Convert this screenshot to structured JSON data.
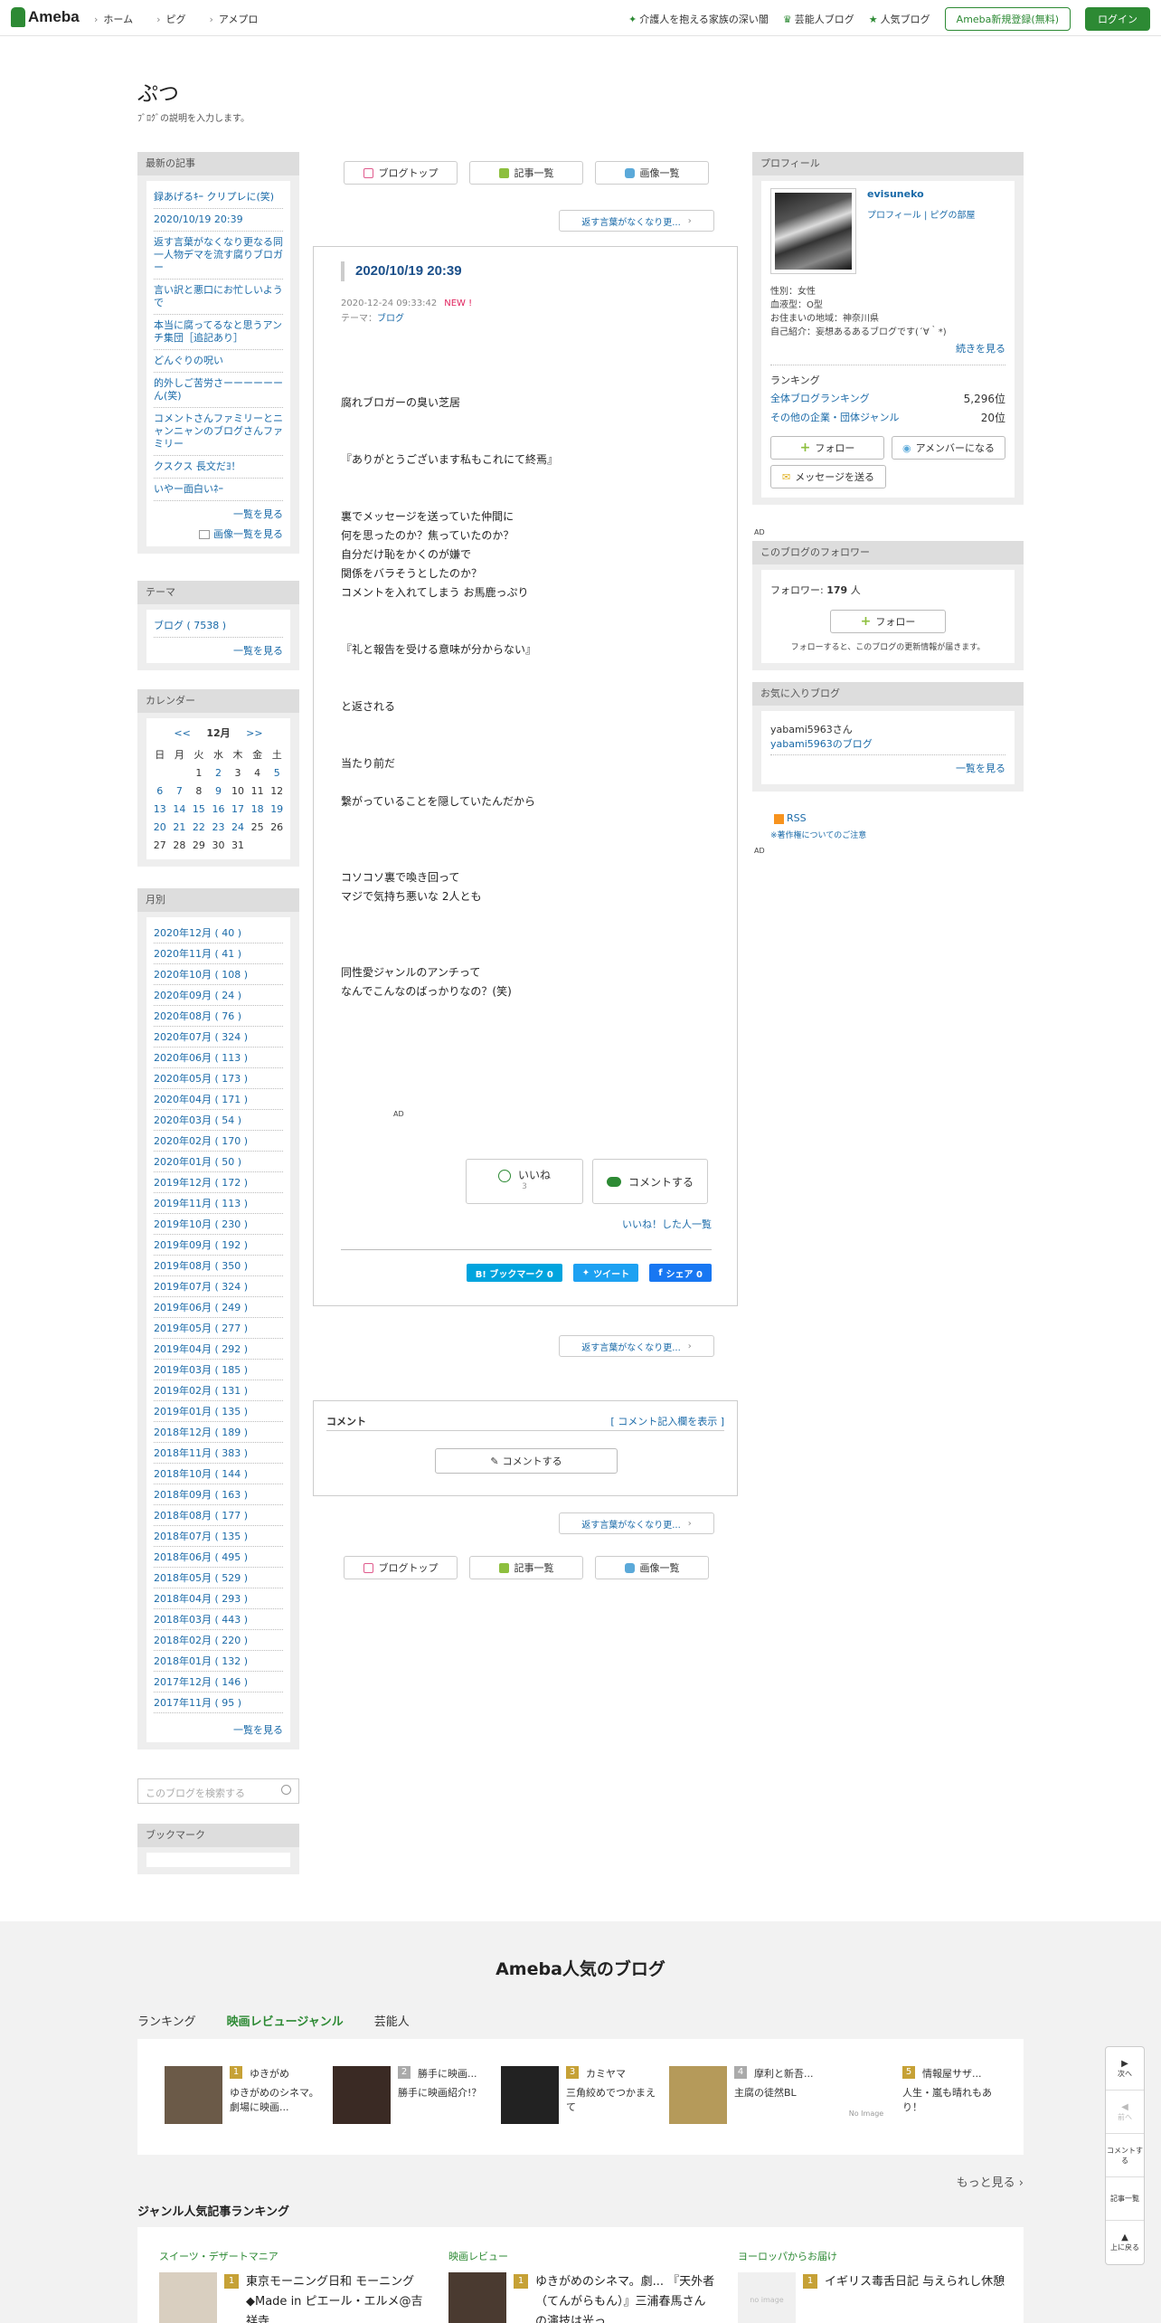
{
  "header": {
    "logo": "Ameba",
    "nav": [
      "ホーム",
      "ピグ",
      "アメプロ"
    ],
    "right_links": [
      "介護人を抱える家族の深い闇",
      "芸能人ブログ",
      "人気ブログ"
    ],
    "register": "Ameba新規登録(無料)",
    "login": "ログイン"
  },
  "blog": {
    "title": "ぷつ",
    "description": "ﾌﾞﾛｸﾞの説明を入力します。"
  },
  "recent": {
    "header": "最新の記事",
    "items": [
      "録あげるｷｰ クリプレに(笑)",
      "2020/10/19 20:39",
      "返す言葉がなくなり更なる同一人物デマを流す腐りブロガー",
      "言い訳と悪口にお忙しいようで",
      "本当に腐ってるなと思うアンチ集団［追記あり］",
      "どんぐりの呪い",
      "的外しご苦労さーーーーーーん(笑)",
      "コメントさんファミリーとニャンニャンのブログさんファミリー",
      "クスクス 長文だﾖ！",
      "いやー面白いﾈｰ"
    ],
    "more": "一覧を見る",
    "images": "画像一覧を見る"
  },
  "theme": {
    "header": "テーマ",
    "item": "ブログ ( 7538 )",
    "more": "一覧を見る"
  },
  "calendar": {
    "header": "カレンダー",
    "prev": "<<",
    "month": "12月",
    "next": ">>",
    "weekdays": [
      "日",
      "月",
      "火",
      "水",
      "木",
      "金",
      "土"
    ],
    "rows": [
      [
        "",
        "",
        "1",
        "2",
        "3",
        "4",
        "5"
      ],
      [
        "6",
        "7",
        "8",
        "9",
        "10",
        "11",
        "12"
      ],
      [
        "13",
        "14",
        "15",
        "16",
        "17",
        "18",
        "19"
      ],
      [
        "20",
        "21",
        "22",
        "23",
        "24",
        "25",
        "26"
      ],
      [
        "27",
        "28",
        "29",
        "30",
        "31",
        "",
        ""
      ]
    ],
    "linked_days": [
      "2",
      "5",
      "6",
      "7",
      "9",
      "13",
      "14",
      "15",
      "16",
      "17",
      "18",
      "19",
      "20",
      "21",
      "22",
      "23",
      "24"
    ]
  },
  "monthly": {
    "header": "月別",
    "items": [
      "2020年12月 ( 40 )",
      "2020年11月 ( 41 )",
      "2020年10月 ( 108 )",
      "2020年09月 ( 24 )",
      "2020年08月 ( 76 )",
      "2020年07月 ( 324 )",
      "2020年06月 ( 113 )",
      "2020年05月 ( 173 )",
      "2020年04月 ( 171 )",
      "2020年03月 ( 54 )",
      "2020年02月 ( 170 )",
      "2020年01月 ( 50 )",
      "2019年12月 ( 172 )",
      "2019年11月 ( 113 )",
      "2019年10月 ( 230 )",
      "2019年09月 ( 192 )",
      "2019年08月 ( 350 )",
      "2019年07月 ( 324 )",
      "2019年06月 ( 249 )",
      "2019年05月 ( 277 )",
      "2019年04月 ( 292 )",
      "2019年03月 ( 185 )",
      "2019年02月 ( 131 )",
      "2019年01月 ( 135 )",
      "2018年12月 ( 189 )",
      "2018年11月 ( 383 )",
      "2018年10月 ( 144 )",
      "2018年09月 ( 163 )",
      "2018年08月 ( 177 )",
      "2018年07月 ( 135 )",
      "2018年06月 ( 495 )",
      "2018年05月 ( 529 )",
      "2018年04月 ( 293 )",
      "2018年03月 ( 443 )",
      "2018年02月 ( 220 )",
      "2018年01月 ( 132 )",
      "2017年12月 ( 146 )",
      "2017年11月 ( 95 )"
    ],
    "more": "一覧を見る"
  },
  "search": {
    "placeholder": "このブログを検索する"
  },
  "bookmark": {
    "header": "ブックマーク"
  },
  "main_nav": {
    "top": "ブログトップ",
    "list": "記事一覧",
    "images": "画像一覧"
  },
  "next_article": "返す言葉がなくなり更...",
  "article": {
    "title": "2020/10/19 20:39",
    "date": "2020-12-24 09:33:42",
    "new": "NEW !",
    "theme_label": "テーマ：",
    "theme": "ブログ",
    "body": [
      "腐れブロガーの臭い芝居",
      "",
      "",
      "『ありがとうございます私もこれにて終焉』",
      "",
      "",
      "裏でメッセージを送っていた仲間に",
      "何を思ったのか？焦っていたのか？",
      "自分だけ恥をかくのが嫌で",
      "関係をバラそうとしたのか？",
      "コメントを入れてしまう お馬鹿っぷり",
      "",
      "",
      "『礼と報告を受ける意味が分からない』",
      "",
      "",
      "と返される",
      "",
      "",
      "当たり前だ",
      "",
      "繋がっていることを隠していたんだから",
      "",
      "",
      "",
      "コソコソ裏で喚き回って",
      "マジで気持ち悪いな 2人とも",
      "",
      "",
      "",
      "同性愛ジャンルのアンチって",
      "なんでこんなのばっかりなの？(笑)"
    ],
    "ad": "AD",
    "like": "いいね",
    "like_count": "3",
    "comment": "コメントする",
    "liked_list": "いいね！した人一覧",
    "share_bookmark": "B! ブックマーク  0",
    "share_tweet": "ツイート",
    "share_facebook": "シェア 0"
  },
  "comments": {
    "header": "コメント",
    "show": "[ コメント記入欄を表示 ]",
    "button": "コメントする"
  },
  "profile": {
    "header": "プロフィール",
    "name": "evisuneko",
    "link_profile": "プロフィール",
    "link_room": "ピグの部屋",
    "info": [
      "性別：女性",
      "血液型：O型",
      "お住まいの地域：神奈川県",
      "自己紹介：妄想あるあるブログです(´∀｀*)"
    ],
    "continue": "続きを見る",
    "ranking_label": "ランキング",
    "rank1_label": "全体ブログランキング",
    "rank1_value": "5,296位",
    "rank2_label": "その他の企業・団体ジャンル",
    "rank2_value": "20位",
    "follow": "フォロー",
    "member": "アメンバーになる",
    "message": "メッセージを送る"
  },
  "right_ad": "AD",
  "followers": {
    "header": "このブログのフォロワー",
    "label": "フォロワー:",
    "count": "179",
    "unit": "人",
    "follow": "フォロー",
    "note": "フォローすると、このブログの更新情報が届きます。"
  },
  "favorites": {
    "header": "お気に入りブログ",
    "user": "yabami5963さん",
    "blog": "yabami5963のブログ",
    "more": "一覧を見る"
  },
  "rss": {
    "label": "RSS",
    "notice": "※著作権についてのご注意"
  },
  "right_ad2": "AD",
  "footer": {
    "title": "Ameba人気のブログ",
    "tabs": [
      "ランキング",
      "映画レビュージャンル",
      "芸能人"
    ],
    "ranking": [
      {
        "rank": "1",
        "name": "ゆきがめ",
        "desc": "ゆきがめのシネマ。劇場に映画..."
      },
      {
        "rank": "2",
        "name": "勝手に映画...",
        "desc": "勝手に映画紹介!？"
      },
      {
        "rank": "3",
        "name": "カミヤマ",
        "desc": "三角絞めでつかまえて"
      },
      {
        "rank": "4",
        "name": "摩利と新吾...",
        "desc": "主腐の徒然BL"
      },
      {
        "rank": "5",
        "name": "情報屋サザ...",
        "desc": "人生・嵐も晴れもあり！"
      }
    ],
    "no_image": "No Image",
    "more": "もっと見る",
    "genre_header": "ジャンル人気記事ランキング",
    "genres": [
      {
        "cat": "スイーツ・デザートマニア",
        "rank": "1",
        "text": "東京モーニング日和 モーニング◆Made in ピエール・エルメ@吉祥寺"
      },
      {
        "cat": "映画レビュー",
        "rank": "1",
        "text": "ゆきがめのシネマ。劇... 『天外者（てんがらもん）』三浦春馬さんの演技は光っ"
      },
      {
        "cat": "ヨーロッパからお届け",
        "rank": "1",
        "text": "イギリス毒舌日記 与えられし休憩"
      }
    ],
    "no_image_small": "no image"
  },
  "side_nav": [
    "次へ",
    "前へ",
    "コメントする",
    "記事一覧",
    "上に戻る"
  ]
}
